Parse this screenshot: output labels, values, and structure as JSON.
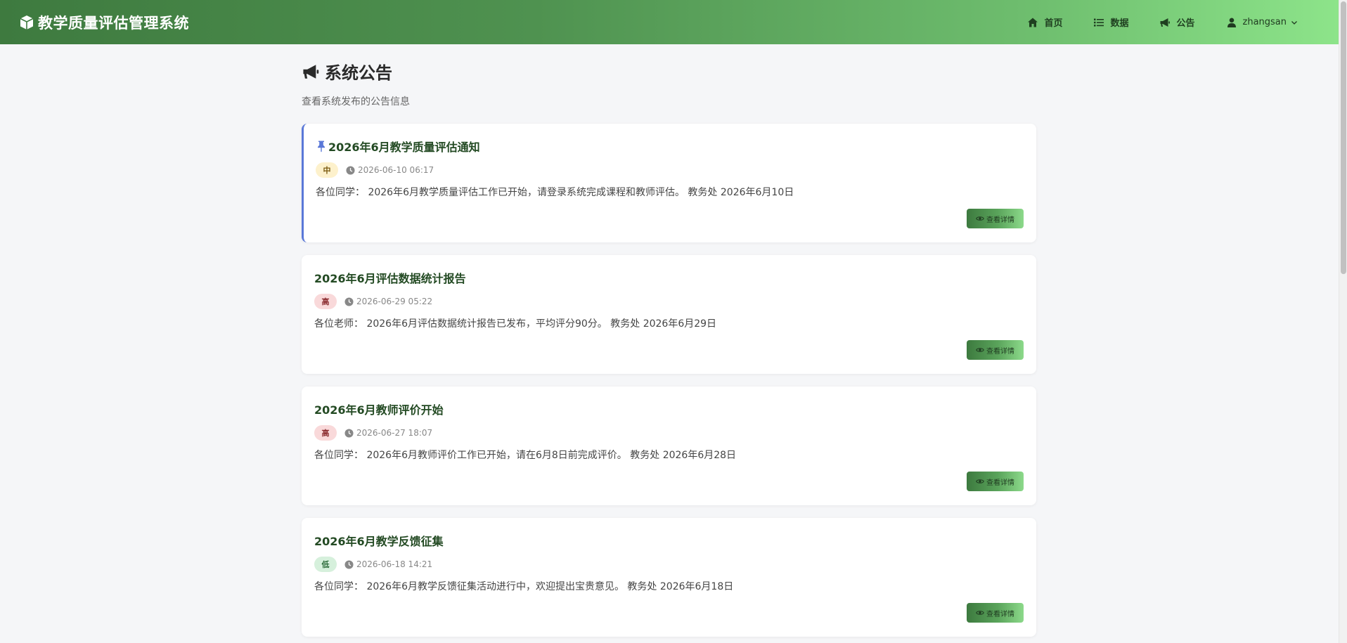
{
  "app": {
    "title": "教学质量评估管理系统"
  },
  "nav": {
    "home": "首页",
    "data": "数据",
    "notice": "公告",
    "user": "zhangsan"
  },
  "page": {
    "title": "系统公告",
    "subtitle": "查看系统发布的公告信息"
  },
  "detail_label": "查看详情",
  "colors": {
    "accent_green": "#3e7a3f",
    "pinned_border": "#5a78d8",
    "priority_mid": "#fdf1cc",
    "priority_high": "#f9d9da",
    "priority_low": "#d6f0dc"
  },
  "announcements": [
    {
      "title": "2026年6月教学质量评估通知",
      "pinned": true,
      "priority": "中",
      "time": "2026-06-10 06:17",
      "content": "各位同学： 2026年6月教学质量评估工作已开始，请登录系统完成课程和教师评估。 教务处 2026年6月10日"
    },
    {
      "title": "2026年6月评估数据统计报告",
      "pinned": false,
      "priority": "高",
      "time": "2026-06-29 05:22",
      "content": "各位老师： 2026年6月评估数据统计报告已发布，平均评分90分。 教务处 2026年6月29日"
    },
    {
      "title": "2026年6月教师评价开始",
      "pinned": false,
      "priority": "高",
      "time": "2026-06-27 18:07",
      "content": "各位同学： 2026年6月教师评价工作已开始，请在6月8日前完成评价。 教务处 2026年6月28日"
    },
    {
      "title": "2026年6月教学反馈征集",
      "pinned": false,
      "priority": "低",
      "time": "2026-06-18 14:21",
      "content": "各位同学： 2026年6月教学反馈征集活动进行中，欢迎提出宝贵意见。 教务处 2026年6月18日"
    }
  ]
}
